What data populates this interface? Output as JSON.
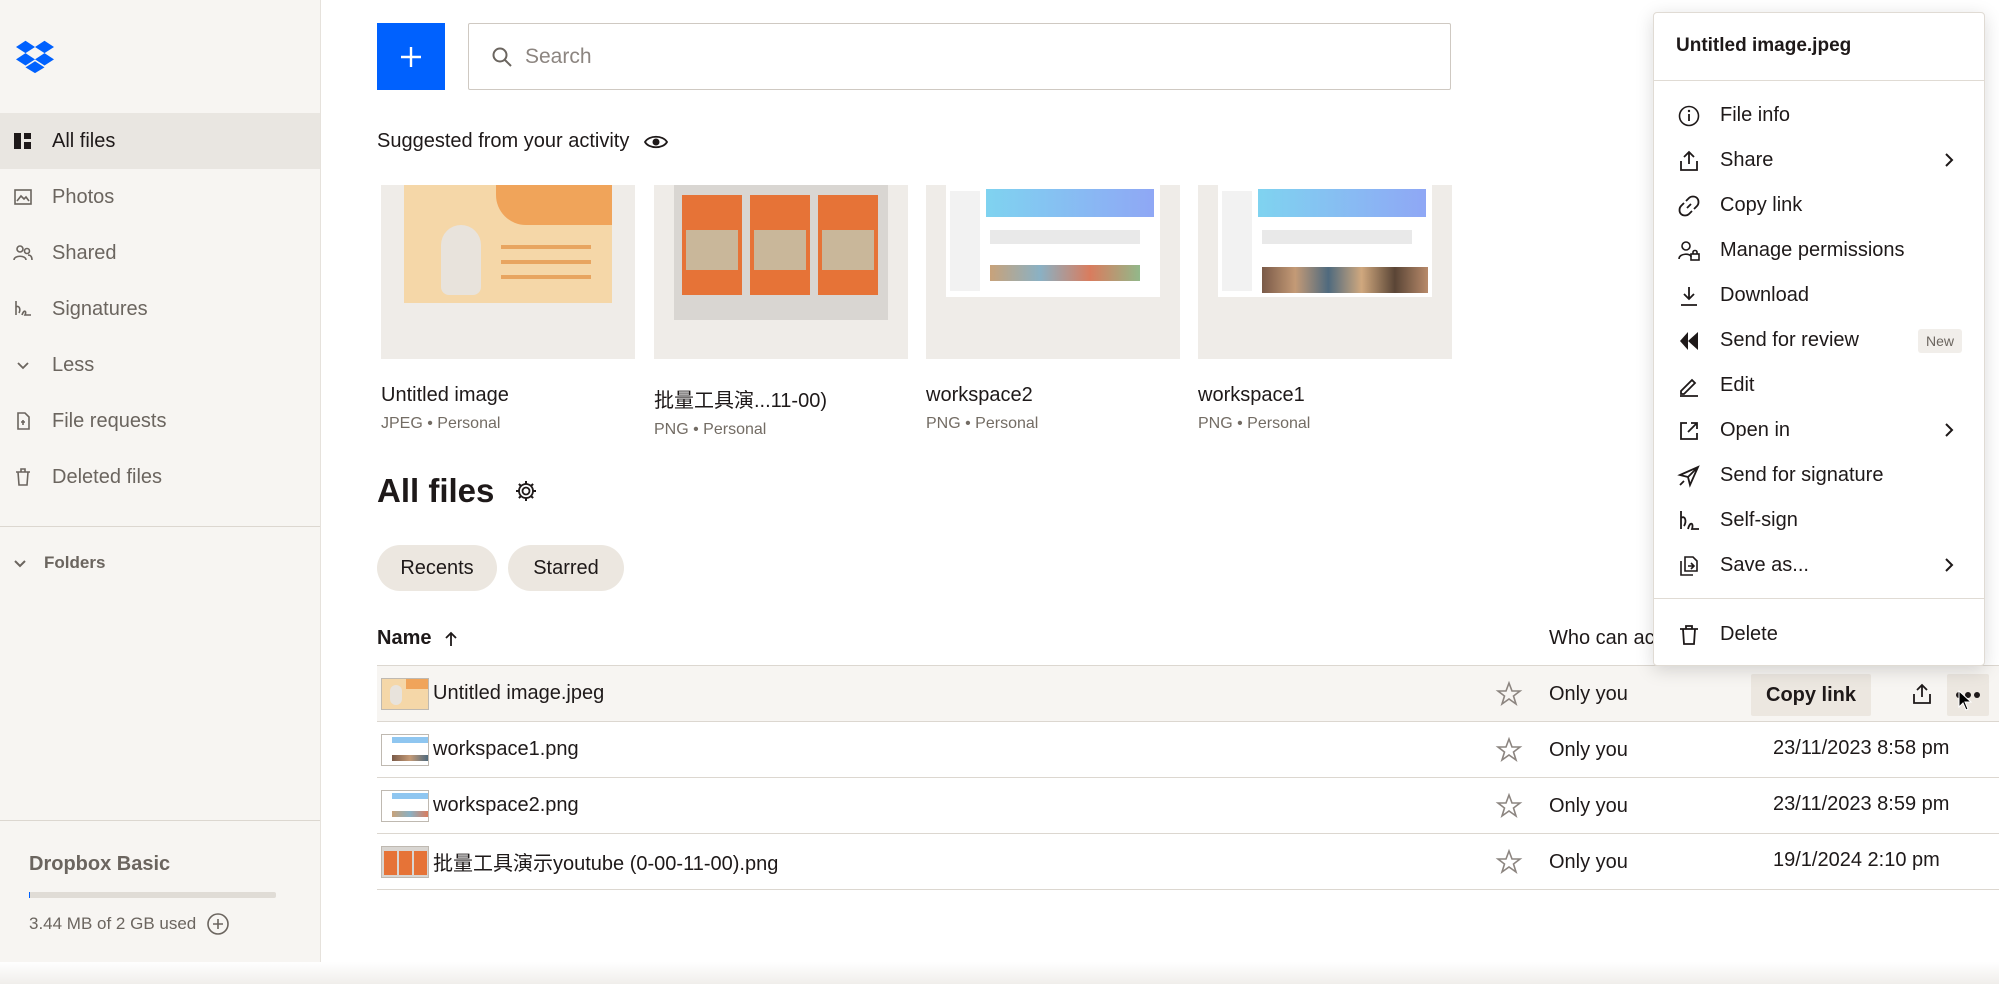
{
  "sidebar": {
    "items": [
      {
        "label": "All files",
        "icon": "all-files-icon"
      },
      {
        "label": "Photos",
        "icon": "photos-icon"
      },
      {
        "label": "Shared",
        "icon": "shared-icon"
      },
      {
        "label": "Signatures",
        "icon": "signatures-icon"
      },
      {
        "label": "Less",
        "icon": "chevron-down-icon"
      },
      {
        "label": "File requests",
        "icon": "file-requests-icon"
      },
      {
        "label": "Deleted files",
        "icon": "trash-icon"
      }
    ],
    "folders_label": "Folders",
    "plan_label": "Dropbox Basic",
    "usage_text": "3.44 MB of 2 GB used",
    "usage_fraction": 0.0017
  },
  "search": {
    "placeholder": "Search"
  },
  "suggested": {
    "heading": "Suggested from your activity",
    "cards": [
      {
        "name": "Untitled image",
        "meta": "JPEG • Personal"
      },
      {
        "name": "批量工具演...11-00)",
        "meta": "PNG • Personal"
      },
      {
        "name": "workspace2",
        "meta": "PNG • Personal"
      },
      {
        "name": "workspace1",
        "meta": "PNG • Personal"
      }
    ]
  },
  "all_files": {
    "title": "All files",
    "chips": [
      "Recents",
      "Starred"
    ],
    "columns": {
      "name": "Name",
      "who": "Who can ac"
    },
    "rows": [
      {
        "name": "Untitled image.jpeg",
        "who": "Only you",
        "modified": "",
        "copy_link": "Copy link"
      },
      {
        "name": "workspace1.png",
        "who": "Only you",
        "modified": "23/11/2023 8:58 pm"
      },
      {
        "name": "workspace2.png",
        "who": "Only you",
        "modified": "23/11/2023 8:59 pm"
      },
      {
        "name": "批量工具演示youtube (0-00-11-00).png",
        "who": "Only you",
        "modified": "19/1/2024 2:10 pm"
      }
    ]
  },
  "menu": {
    "title": "Untitled image.jpeg",
    "items": [
      {
        "label": "File info",
        "icon": "info-icon"
      },
      {
        "label": "Share",
        "icon": "share-icon",
        "submenu": true
      },
      {
        "label": "Copy link",
        "icon": "link-icon"
      },
      {
        "label": "Manage permissions",
        "icon": "permissions-icon"
      },
      {
        "label": "Download",
        "icon": "download-icon"
      },
      {
        "label": "Send for review",
        "icon": "review-icon",
        "badge": "New"
      },
      {
        "label": "Edit",
        "icon": "pencil-icon"
      },
      {
        "label": "Open in",
        "icon": "open-in-icon",
        "submenu": true
      },
      {
        "label": "Send for signature",
        "icon": "send-signature-icon"
      },
      {
        "label": "Self-sign",
        "icon": "self-sign-icon"
      },
      {
        "label": "Save as...",
        "icon": "save-as-icon",
        "submenu": true
      },
      {
        "label": "Delete",
        "icon": "trash-icon"
      }
    ]
  },
  "colors": {
    "accent": "#0061fe",
    "sidebar_bg": "#f7f5f2",
    "chip_bg": "#ece7e0"
  }
}
